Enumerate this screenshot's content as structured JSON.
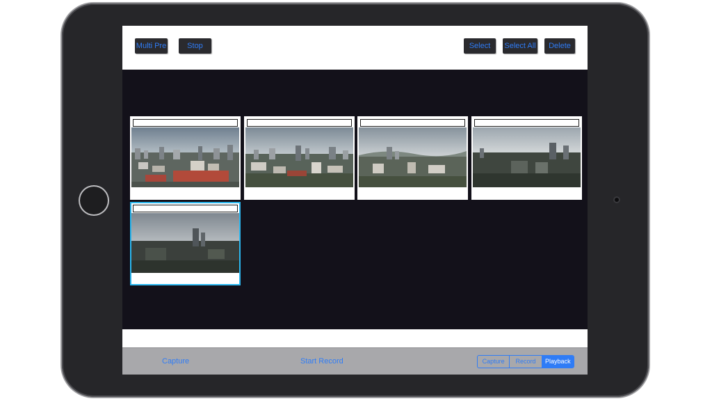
{
  "toolbar": {
    "left_buttons": [
      "Multi Pre",
      "Stop"
    ],
    "right_buttons": [
      "Select",
      "Select All",
      "Delete"
    ]
  },
  "gallery": {
    "items": [
      {
        "label": "",
        "selected": false,
        "scene": "city-red-roofs"
      },
      {
        "label": "",
        "selected": false,
        "scene": "city-green"
      },
      {
        "label": "",
        "selected": false,
        "scene": "city-hazy"
      },
      {
        "label": "",
        "selected": false,
        "scene": "city-dusk"
      },
      {
        "label": "",
        "selected": true,
        "scene": "city-overcast"
      }
    ]
  },
  "bottombar": {
    "capture": "Capture",
    "start_record": "Start Record",
    "segments": [
      "Capture",
      "Record",
      "Playback"
    ],
    "active_segment": "Playback"
  },
  "colors": {
    "accent": "#2f7cf6",
    "selection": "#2bb8f0",
    "gallery_bg": "#13111a"
  }
}
